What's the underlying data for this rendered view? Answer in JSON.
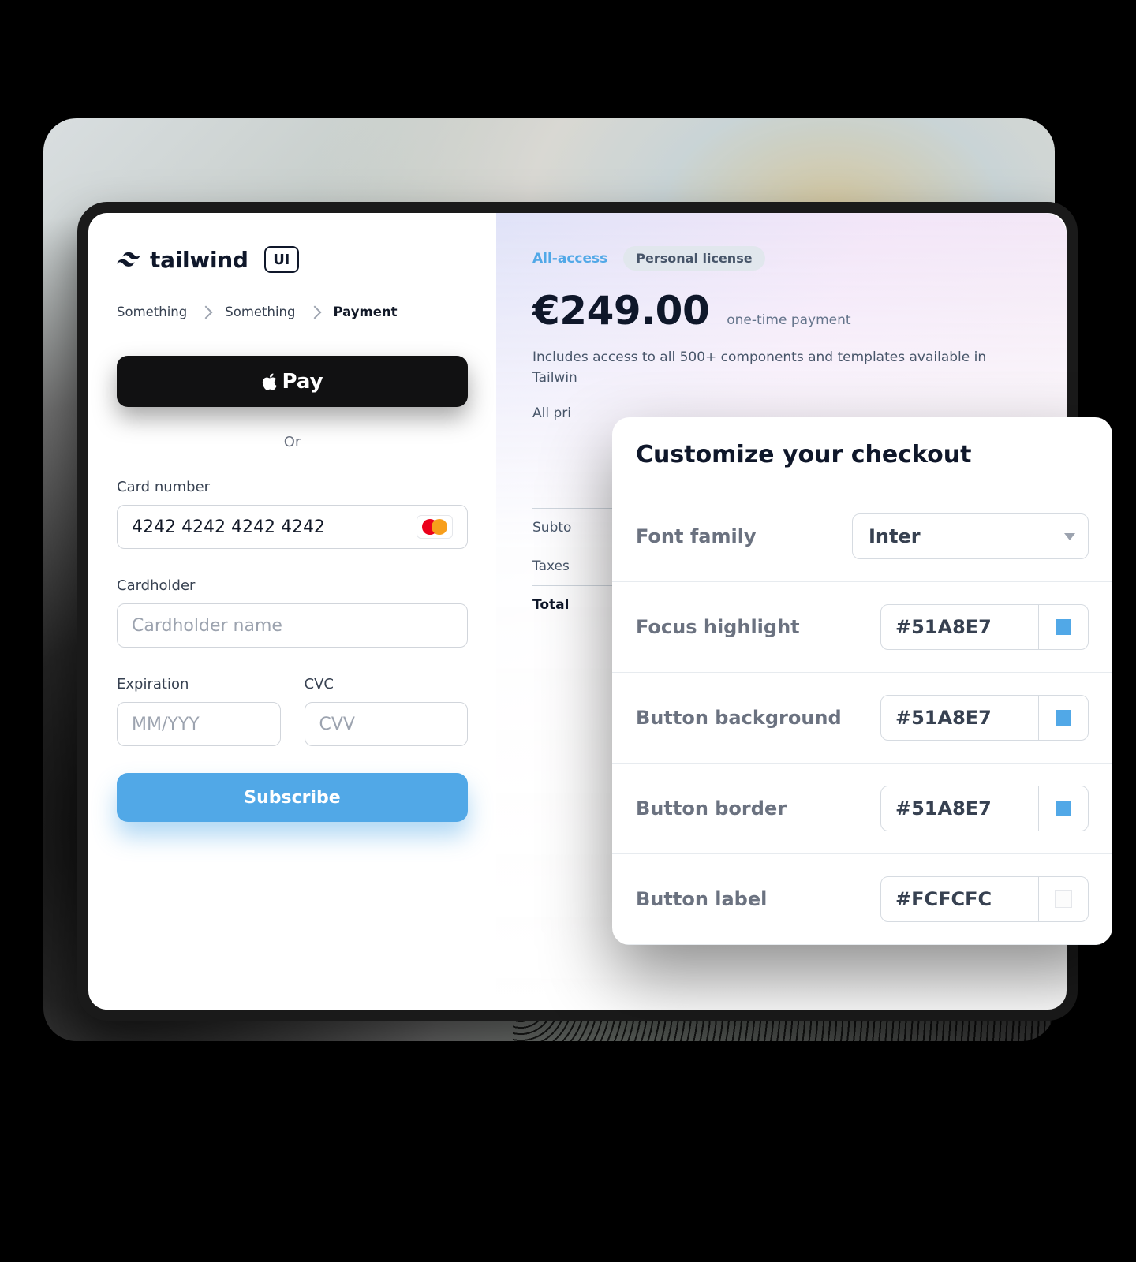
{
  "brand": {
    "name": "tailwind",
    "badge": "UI"
  },
  "breadcrumbs": {
    "items": [
      "Something",
      "Something",
      "Payment"
    ],
    "active_index": 2
  },
  "applepay": {
    "label": "Pay"
  },
  "divider": {
    "label": "Or"
  },
  "fields": {
    "card_number": {
      "label": "Card number",
      "value": "4242 4242 4242 4242"
    },
    "cardholder": {
      "label": "Cardholder",
      "placeholder": "Cardholder name"
    },
    "expiration": {
      "label": "Expiration",
      "placeholder": "MM/YYY"
    },
    "cvc": {
      "label": "CVC",
      "placeholder": "CVV"
    }
  },
  "subscribe": {
    "label": "Subscribe",
    "bg": "#51A8E7"
  },
  "summary": {
    "plan_link": "All-access",
    "license_pill": "Personal license",
    "amount": "€249.00",
    "amount_hint": "one-time payment",
    "desc_line1": "Includes access to all 500+ components and templates available in Tailwin",
    "desc_line2": "All pri",
    "rows": {
      "subtotal_label": "Subto",
      "taxes_label": "Taxes",
      "total_label": "Total"
    }
  },
  "modal": {
    "title": "Customize your checkout",
    "rows": [
      {
        "label": "Font family",
        "type": "select",
        "value": "Inter"
      },
      {
        "label": "Focus highlight",
        "type": "color",
        "value": "#51A8E7"
      },
      {
        "label": "Button background",
        "type": "color",
        "value": "#51A8E7"
      },
      {
        "label": "Button border",
        "type": "color",
        "value": "#51A8E7"
      },
      {
        "label": "Button label",
        "type": "color",
        "value": "#FCFCFC"
      }
    ]
  }
}
